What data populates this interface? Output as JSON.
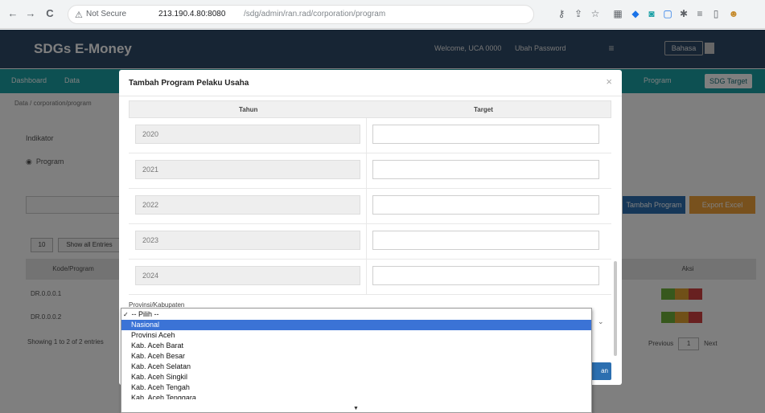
{
  "browser": {
    "security_label": "Not Secure",
    "url_host": "213.190.4.80:8080",
    "url_path": "/sdg/admin/ran.rad/corporation/program",
    "nav_back": "←",
    "nav_forward": "→",
    "nav_reload": "C"
  },
  "app": {
    "brand": "SDGs E-Money",
    "welcome": "Welcome, UCA 0000",
    "change_password": "Ubah Password",
    "header_button": "Bahasa",
    "menu_items": [
      "Dashboard",
      "Data",
      "Program"
    ],
    "menu_active": "SDG Target",
    "breadcrumb": "Data / corporation/program",
    "page_label": "Indikator",
    "program_label": "Program",
    "btn_add_program": "Tambah Program",
    "btn_export": "Export Excel",
    "pills": [
      "10",
      "Show all Entries"
    ],
    "th_left": "Kode/Program",
    "th_right": "Aksi",
    "rows": [
      "DR.0.0.0.1",
      "DR.0.0.0.2"
    ],
    "info": "Showing 1 to 2 of 2 entries",
    "pager_prev": "Previous",
    "pager_page": "1",
    "pager_next": "Next"
  },
  "modal": {
    "title": "Tambah Program Pelaku Usaha",
    "close": "×",
    "col_tahun": "Tahun",
    "col_target": "Target",
    "years": [
      "2020",
      "2021",
      "2022",
      "2023",
      "2024"
    ],
    "select_label": "Provinsi/Kabupaten",
    "submit_peek": "an"
  },
  "dropdown": {
    "options": [
      "-- Pilih --",
      "Nasional",
      "Provinsi Aceh",
      "Kab. Aceh Barat",
      "Kab. Aceh Besar",
      "Kab. Aceh Selatan",
      "Kab. Aceh Singkil",
      "Kab. Aceh Tengah",
      "Kab. Aceh Tenggara"
    ],
    "checked_index": 0,
    "highlighted_index": 1,
    "scroll_arrow": "▼"
  },
  "colors": {
    "highlight": "#3b73d6",
    "header": "#2e4a69",
    "menu": "#1aa0a5"
  }
}
